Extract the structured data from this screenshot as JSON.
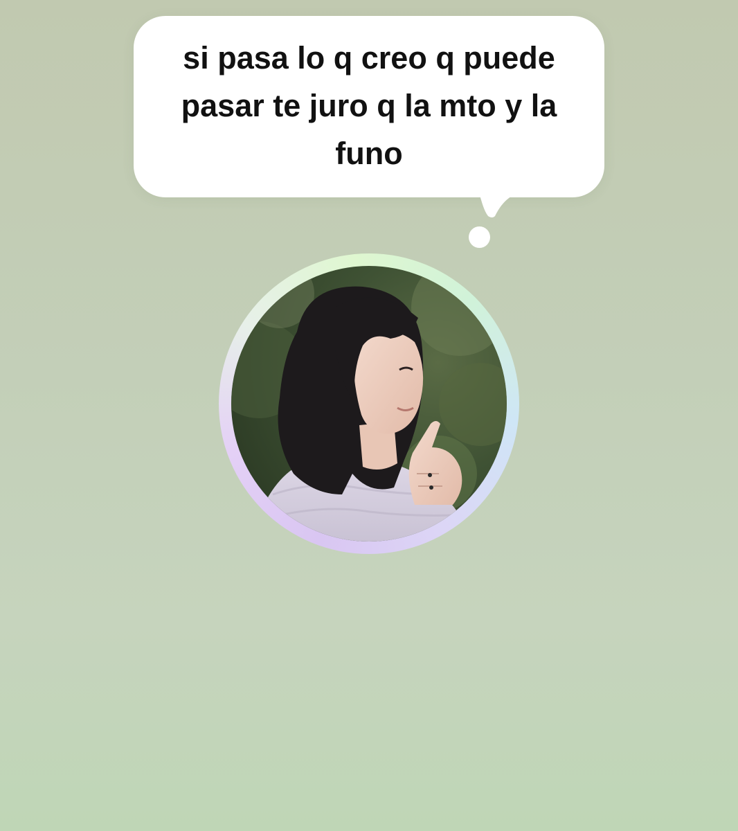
{
  "note": {
    "text": "si pasa lo q creo q puede pasar te juro q la mto y la funo"
  },
  "profile": {
    "photo_alt": ""
  },
  "colors": {
    "bubble": "#ffffff",
    "text": "#111111",
    "background_top": "#c1c9b0",
    "background_bottom": "#bfd6b6"
  }
}
